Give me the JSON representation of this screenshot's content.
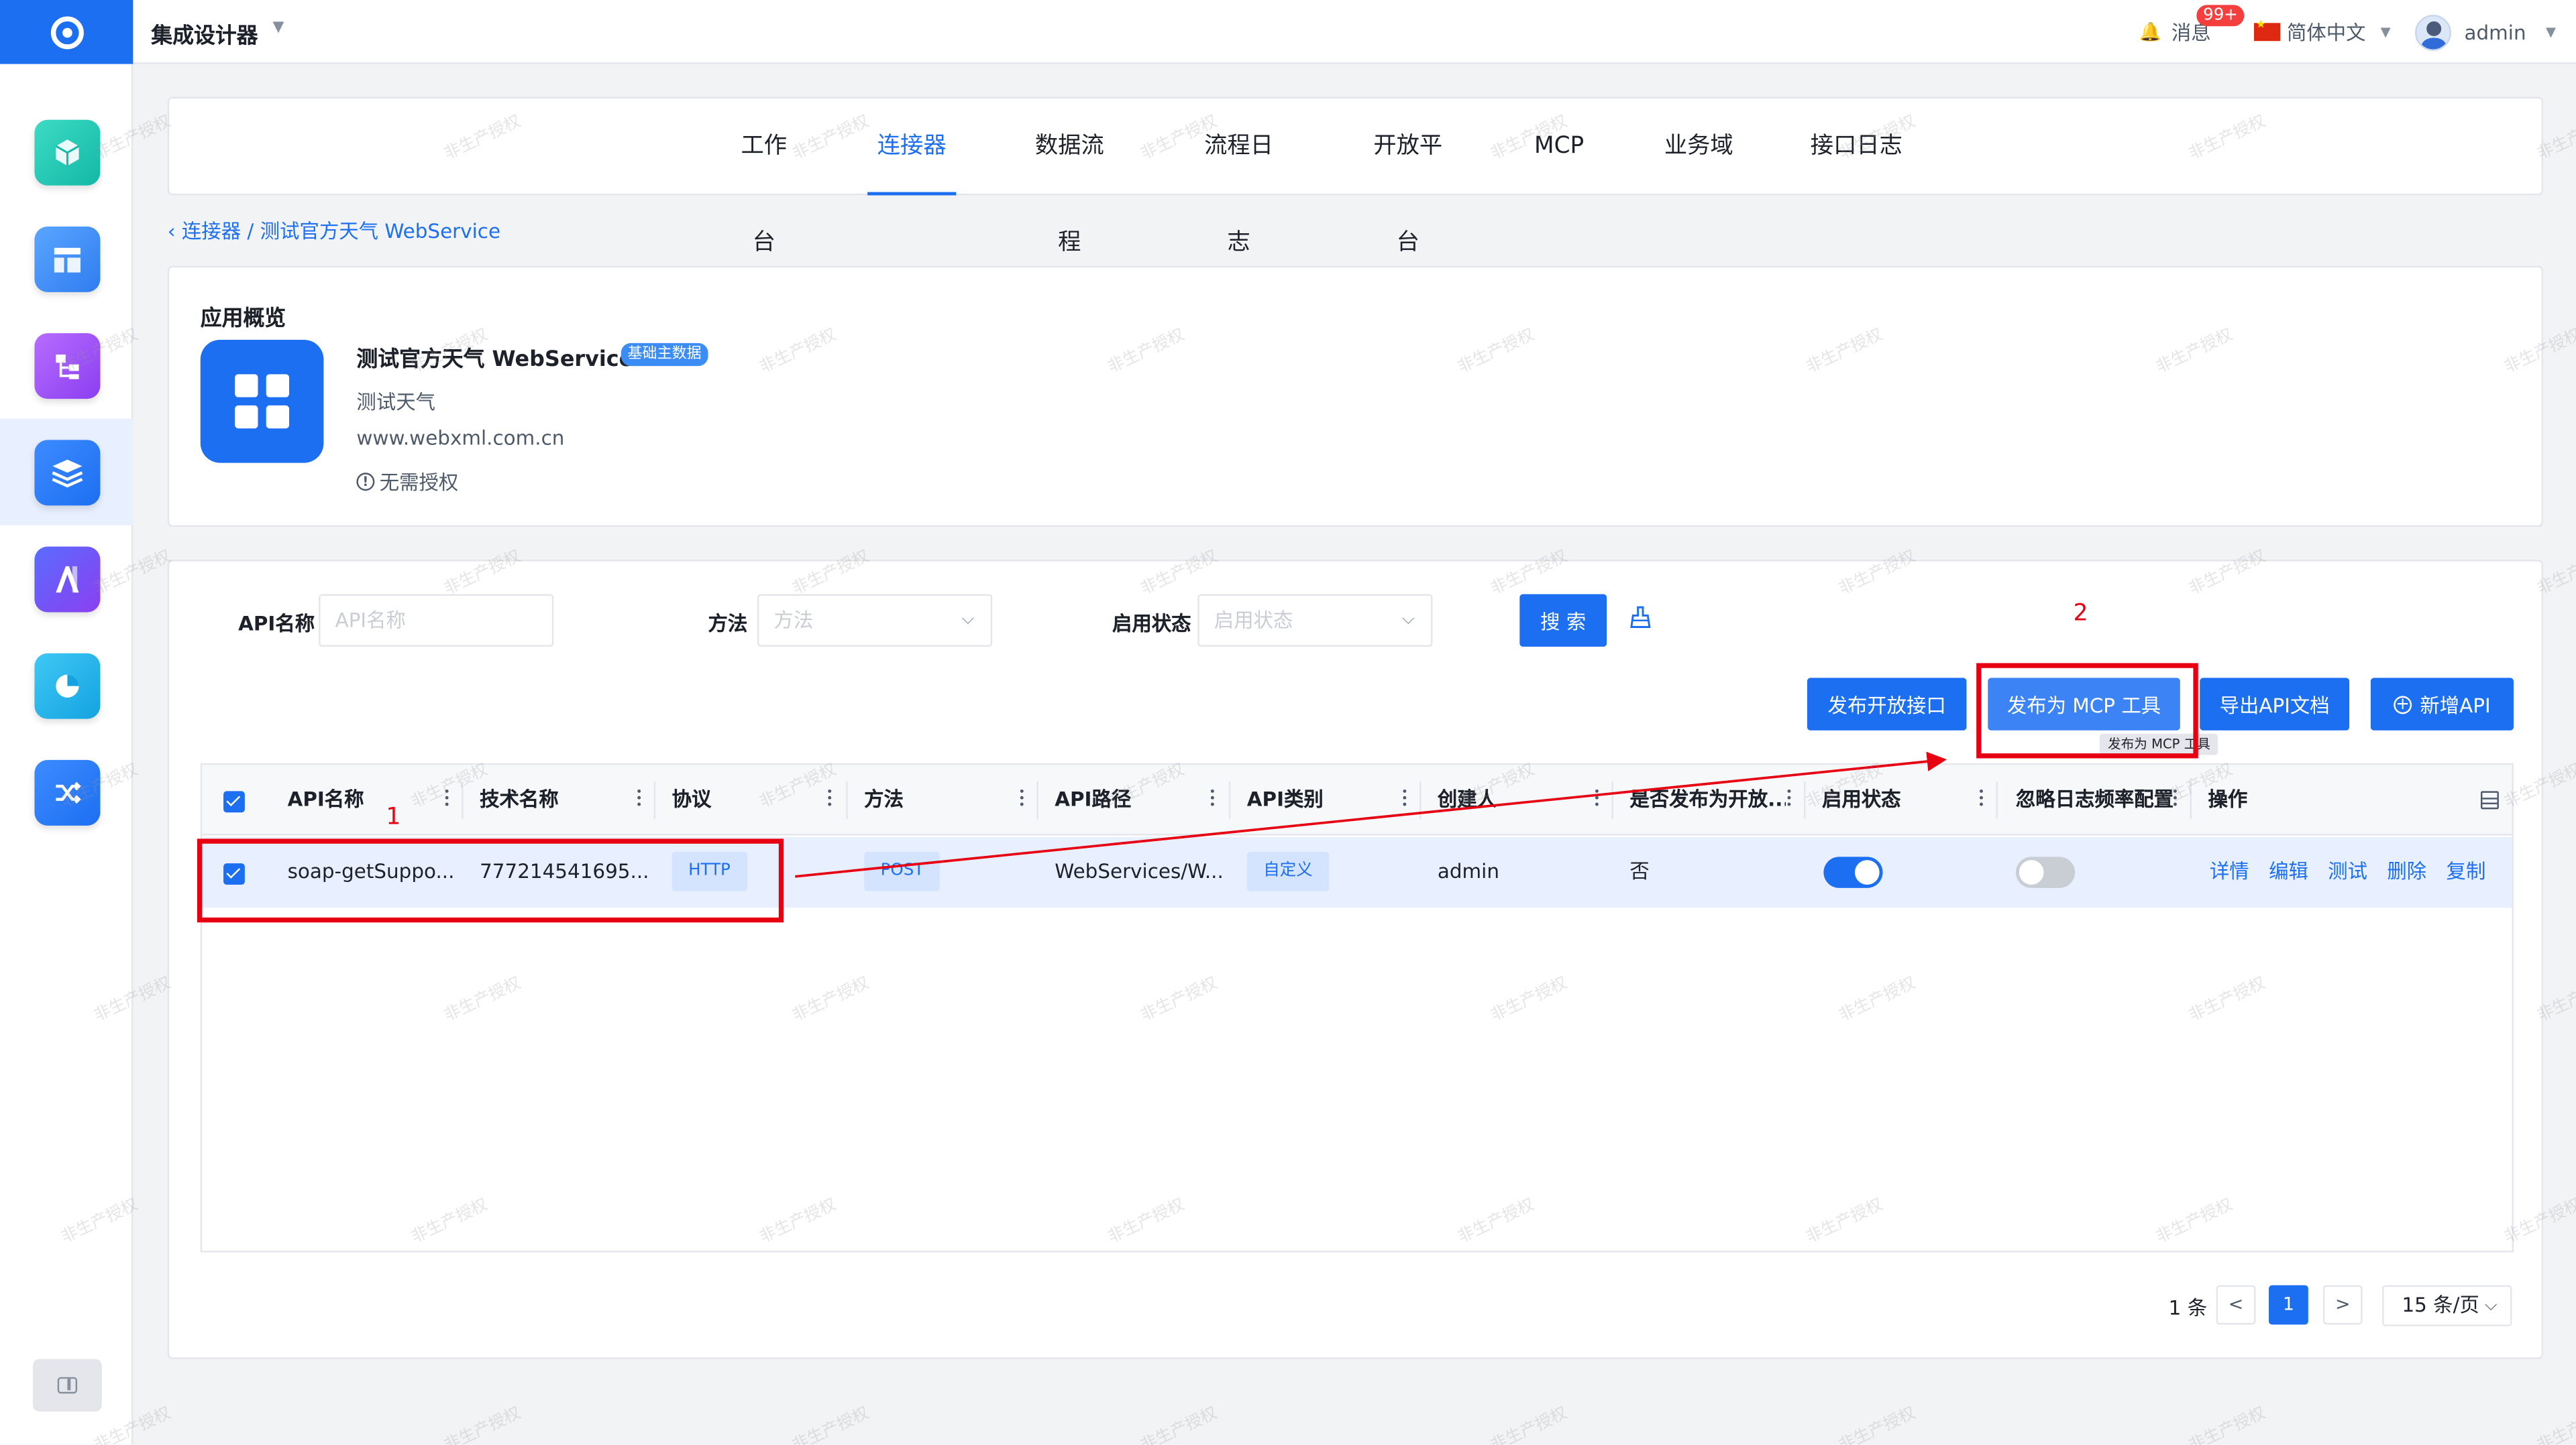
{
  "app": {
    "title": "集成设计器"
  },
  "topbar": {
    "messages_label": "消息",
    "messages_badge": "99+",
    "language": "简体中文",
    "user": "admin"
  },
  "nav": {
    "tabs": [
      {
        "label": "工作台",
        "active": false
      },
      {
        "label": "连接器",
        "active": true
      },
      {
        "label": "数据流程",
        "active": false
      },
      {
        "label": "流程日志",
        "active": false
      },
      {
        "label": "开放平台",
        "active": false
      },
      {
        "label": "MCP",
        "active": false
      },
      {
        "label": "业务域",
        "active": false
      },
      {
        "label": "接口日志",
        "active": false
      }
    ]
  },
  "breadcrumb": {
    "text": "连接器 / 测试官方天气 WebService"
  },
  "overview": {
    "section_title": "应用概览",
    "name": "测试官方天气 WebService",
    "tag": "基础主数据",
    "description": "测试天气",
    "url": "www.webxml.com.cn",
    "auth": "无需授权"
  },
  "filters": {
    "api_name_label": "API名称",
    "api_name_placeholder": "API名称",
    "method_label": "方法",
    "method_placeholder": "方法",
    "status_label": "启用状态",
    "status_placeholder": "启用状态",
    "search_button": "搜 索"
  },
  "actions": {
    "publish_open": "发布开放接口",
    "publish_mcp": "发布为 MCP 工具",
    "export_doc": "导出API文档",
    "add_api": "新增API",
    "tooltip": "发布为 MCP 工具"
  },
  "table": {
    "columns": [
      "API名称",
      "技术名称",
      "协议",
      "方法",
      "API路径",
      "API类别",
      "创建人",
      "是否发布为开放...",
      "启用状态",
      "忽略日志频率配置",
      "操作"
    ],
    "rows": [
      {
        "selected": true,
        "api_name": "soap-getSuppo...",
        "tech_name": "777214541695...",
        "protocol": "HTTP",
        "method": "POST",
        "path": "WebServices/W...",
        "category": "自定义",
        "creator": "admin",
        "published_open": "否",
        "enabled": true,
        "ignore_log_rate": false,
        "ops": [
          "详情",
          "编辑",
          "测试",
          "删除",
          "复制"
        ]
      }
    ]
  },
  "pagination": {
    "total": "1 条",
    "prev": "<",
    "page": "1",
    "next": ">",
    "page_size": "15 条/页"
  },
  "annotations": {
    "one": "1",
    "two": "2"
  },
  "watermark": "非生产授权",
  "colors": {
    "primary": "#1d6ff2",
    "annotation": "#e60012"
  },
  "sidebar_icons": [
    "cube-icon",
    "layout-icon",
    "flow-icon",
    "layers-icon",
    "ai-icon",
    "chart-pie-icon",
    "shuffle-icon"
  ]
}
